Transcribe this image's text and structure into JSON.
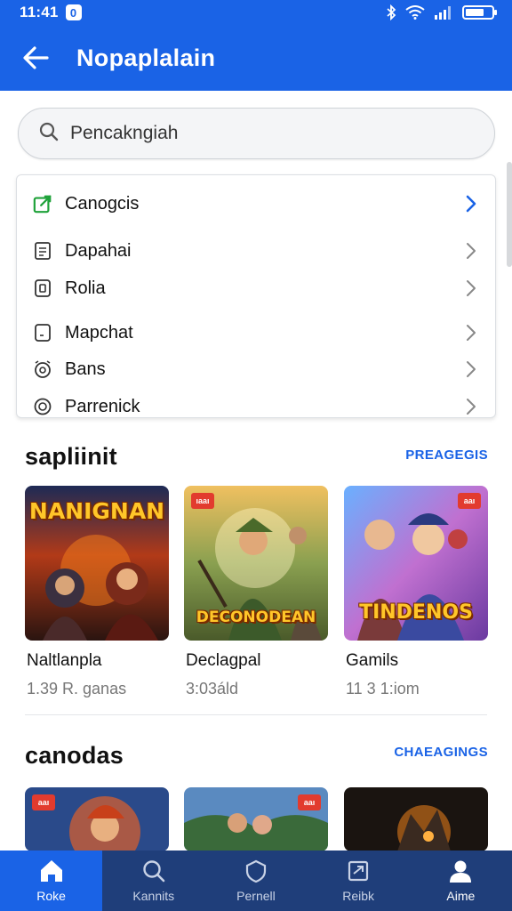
{
  "status_bar": {
    "time": "11:41",
    "badge": "0"
  },
  "app_bar": {
    "title": "Nopaplalain"
  },
  "search": {
    "placeholder": "Pencakngiah"
  },
  "menu": {
    "items": [
      {
        "label": "Canogcis",
        "icon": "edit-icon"
      },
      {
        "label": "Dapahai",
        "icon": "document-icon"
      },
      {
        "label": "Rolia",
        "icon": "file-icon"
      },
      {
        "label": "Mapchat",
        "icon": "page-icon"
      },
      {
        "label": "Bans",
        "icon": "alarm-icon"
      },
      {
        "label": "Parrenick",
        "icon": "circle-icon"
      }
    ]
  },
  "section1": {
    "title": "sapliinit",
    "link": "PREAGEGIS",
    "games": [
      {
        "name": "Naltlanpla",
        "meta": "1.39 R. ganas",
        "logo": "NANIGNAN",
        "tag": ""
      },
      {
        "name": "Declagpal",
        "meta": "3:03áld",
        "logo": "DECONODEAN",
        "tag": "ıaaı"
      },
      {
        "name": "Gamils",
        "meta": "11 3 1:iom",
        "logo": "TINDENOS",
        "tag": "aaı"
      }
    ]
  },
  "section2": {
    "title": "canodas",
    "link": "CHAEAGINGS",
    "games": [
      {
        "tag": "aaı"
      },
      {
        "tag": "aaı"
      },
      {
        "tag": ""
      }
    ]
  },
  "bottom_nav": {
    "items": [
      {
        "label": "Roke",
        "icon": "home-icon",
        "active": true
      },
      {
        "label": "Kannits",
        "icon": "search-icon",
        "active": false
      },
      {
        "label": "Pernell",
        "icon": "shield-icon",
        "active": false
      },
      {
        "label": "Reibk",
        "icon": "box-icon",
        "active": false
      },
      {
        "label": "Aime",
        "icon": "profile-icon",
        "active": false
      }
    ]
  },
  "colors": {
    "primary": "#1a63e6",
    "nav_bg": "#1f3e7a",
    "tag_red": "#e23b2e"
  }
}
